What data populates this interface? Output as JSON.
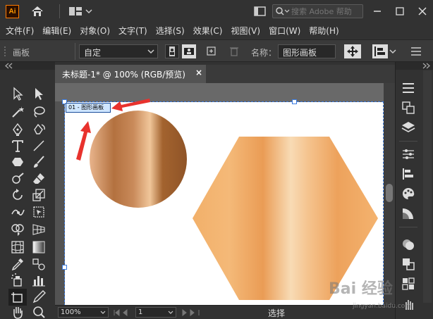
{
  "app": {
    "logo_text": "Ai",
    "search_placeholder": "搜索 Adobe 帮助"
  },
  "menu": [
    "文件(F)",
    "编辑(E)",
    "对象(O)",
    "文字(T)",
    "选择(S)",
    "效果(C)",
    "视图(V)",
    "窗口(W)",
    "帮助(H)"
  ],
  "controlbar": {
    "panel_label": "画板",
    "preset_value": "自定",
    "name_label": "名称：",
    "name_value": "图形画板"
  },
  "document": {
    "tab_title": "未标题-1* @ 100% (RGB/预览)",
    "tab_close": "×",
    "artboard_label": "01 - 图形画板"
  },
  "statusbar": {
    "zoom": "100%",
    "page": "1",
    "status": "选择"
  },
  "watermark": {
    "text": "Bai 经验",
    "sub": "jingyan.baidu.com"
  },
  "colors": {
    "accent": "#ff9a00",
    "arrow": "#e8322d",
    "gradient_dark": "#b0703f",
    "gradient_light": "#f5c89a"
  }
}
